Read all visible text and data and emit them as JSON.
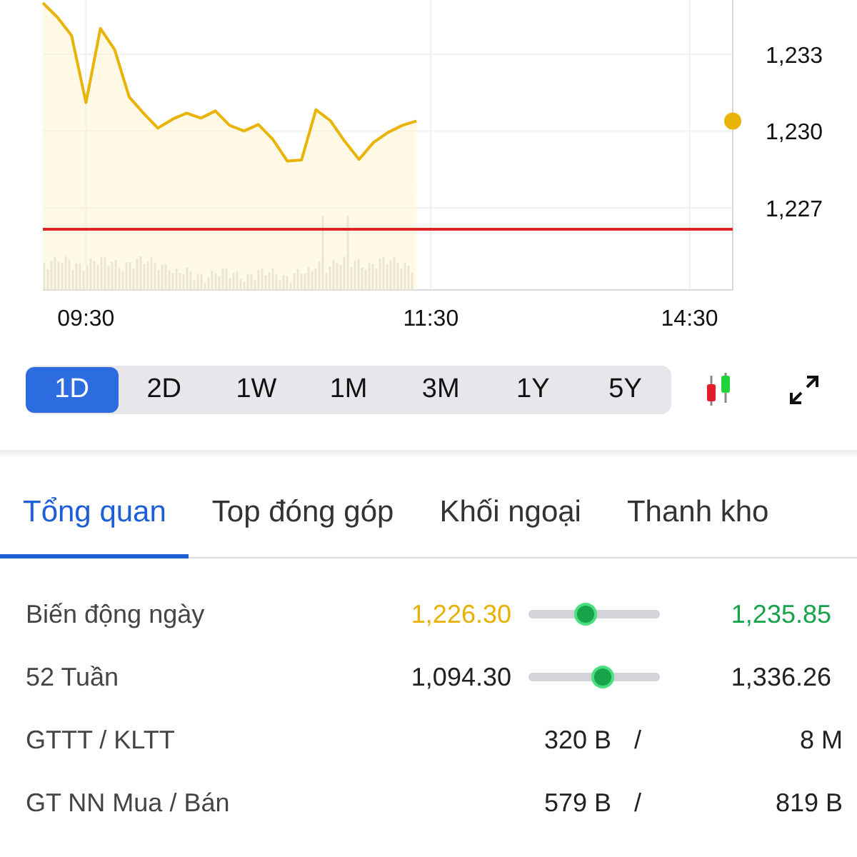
{
  "chart": {
    "chart_data": {
      "type": "area",
      "categories": [
        null,
        null,
        null,
        "09:30",
        null,
        null,
        null,
        null,
        null,
        null,
        null,
        null,
        null,
        null,
        null,
        null,
        null,
        null,
        null,
        null,
        null,
        null,
        null,
        null,
        null,
        null,
        null,
        "11:30",
        null,
        null,
        null,
        null,
        null,
        null,
        null,
        null,
        null,
        null,
        null,
        null,
        null,
        null,
        null,
        null,
        null,
        "14:30",
        null,
        null,
        null
      ],
      "series": [
        {
          "color": "#eab308",
          "values": [
            1235.0,
            1234.44,
            1233.72,
            1231.11,
            1234.0,
            1233.17,
            1231.33,
            1230.7,
            1230.11,
            1230.45,
            1230.7,
            1230.5,
            1230.78,
            1230.22,
            1230.0,
            1230.25,
            1229.67,
            1228.83,
            1228.87,
            1230.83,
            1230.4,
            1229.6,
            1228.89,
            1229.55,
            1229.94,
            1230.22,
            1230.39,
            null,
            null,
            null,
            null,
            null,
            null,
            null,
            null,
            null,
            null,
            null,
            null,
            null,
            null,
            null,
            null,
            null,
            null,
            null,
            null,
            null,
            null
          ]
        }
      ],
      "ylim": [
        1223.8,
        1235.11
      ],
      "yticks": [
        {
          "value": 1233,
          "label": "1,233"
        },
        {
          "value": 1230,
          "label": "1,230"
        },
        {
          "value": 1227,
          "label": "1,227"
        }
      ],
      "grid": true,
      "ref_lines": [
        {
          "axis": "y",
          "value": 1226.17,
          "color": "#dc2626"
        }
      ]
    }
  },
  "ranges": [
    {
      "label": "1D",
      "selected": true
    },
    {
      "label": "2D",
      "selected": false
    },
    {
      "label": "1W",
      "selected": false
    },
    {
      "label": "1M",
      "selected": false
    },
    {
      "label": "3M",
      "selected": false
    },
    {
      "label": "1Y",
      "selected": false
    },
    {
      "label": "5Y",
      "selected": false
    }
  ],
  "tabs": [
    {
      "label": "Tổng quan",
      "selected": true
    },
    {
      "label": "Top đóng góp",
      "selected": false
    },
    {
      "label": "Khối ngoại",
      "selected": false
    },
    {
      "label": "Thanh kho",
      "selected": false
    }
  ],
  "rows": [
    {
      "kind": "range",
      "label": "Biến động ngày",
      "low": {
        "text": "1,226.30",
        "color": "#e8b100"
      },
      "level": 0.43,
      "high": {
        "text": "1,235.85",
        "color": "#16a34a"
      }
    },
    {
      "kind": "range",
      "label": "52 Tuần",
      "low": {
        "text": "1,094.30",
        "color": "#222222"
      },
      "level": 0.56,
      "high": {
        "text": "1,336.26",
        "color": "#222222"
      }
    },
    {
      "kind": "ratio",
      "label": "GTTT / KLTT",
      "first": "320 B",
      "separator": "/",
      "second": "8 M"
    },
    {
      "kind": "ratio",
      "label": "GT NN Mua / Bán",
      "first": "579 B",
      "separator": "/",
      "second": "819 B"
    }
  ]
}
